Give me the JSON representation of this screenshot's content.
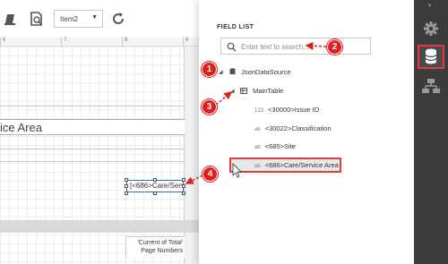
{
  "toolbar": {
    "combo_value": "Item2",
    "combo_caret": "▼"
  },
  "ruler": {
    "numbers": [
      "6",
      "7",
      "8",
      "9"
    ]
  },
  "designer": {
    "service_area_text": "ice Area",
    "selected_control_text": "[<686>Care/Serv",
    "page_number_line1": "'Current of Total'",
    "page_number_line2": "Page Numbers"
  },
  "field_list": {
    "title": "FIELD LIST",
    "search_placeholder": "Enter text to search...",
    "datasource": "JsonDataSource",
    "table": "MainTable",
    "fields": [
      {
        "type": "123",
        "label": "<30000>Issue ID"
      },
      {
        "type": "ab",
        "label": "<30022>Classification"
      },
      {
        "type": "ab",
        "label": "<685>Site"
      },
      {
        "type": "ab",
        "label": "<686>Care/Service Area"
      }
    ]
  },
  "sidebar": {
    "collapse_glyph": "›",
    "buttons": [
      "gear-icon",
      "database-icon",
      "hierarchy-icon"
    ]
  },
  "callouts": [
    "1",
    "2",
    "3",
    "4"
  ],
  "colors": {
    "accent_red": "#e01e1e",
    "sidebar_bg": "#3c3c3c",
    "selection_blue": "#2e6fc4"
  }
}
